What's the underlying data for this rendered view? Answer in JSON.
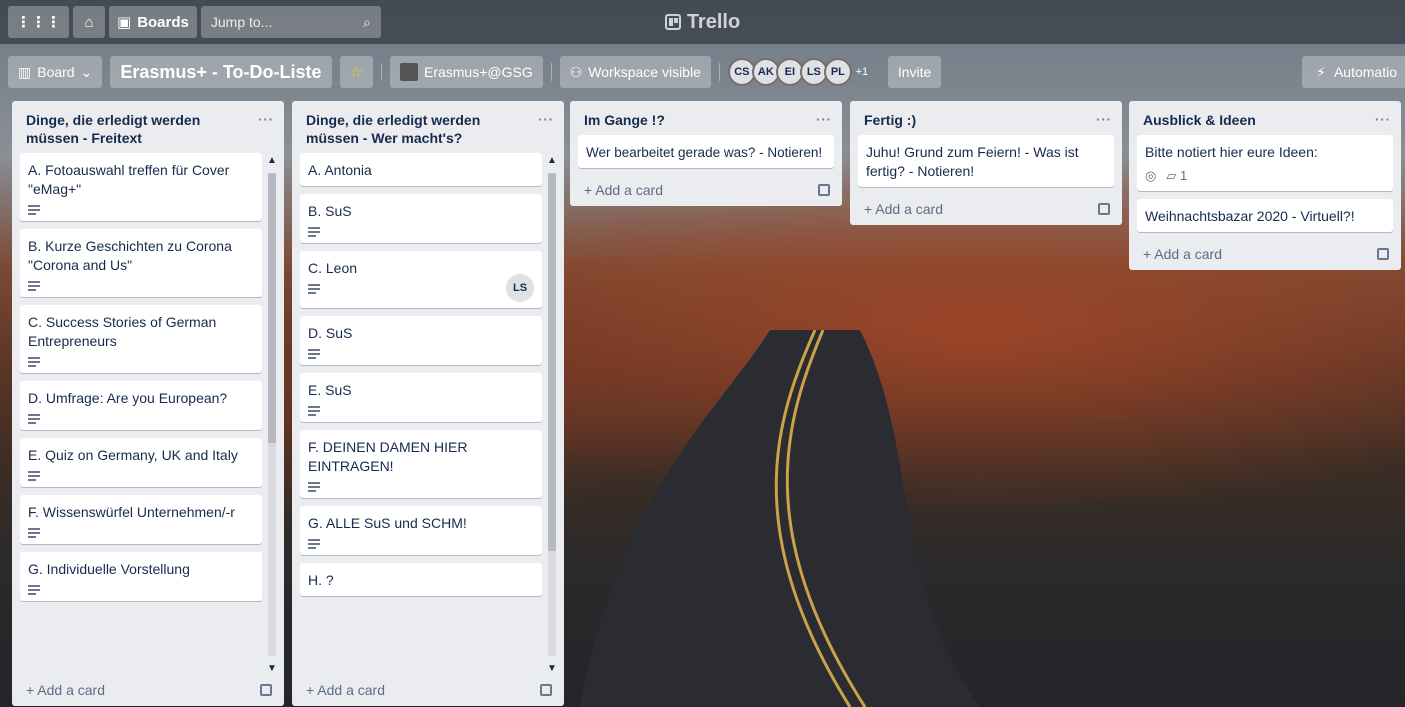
{
  "header": {
    "boards_label": "Boards",
    "search_placeholder": "Jump to...",
    "logo": "Trello"
  },
  "boardbar": {
    "view_label": "Board",
    "title": "Erasmus+ - To-Do-Liste",
    "workspace": "Erasmus+@GSG",
    "visibility": "Workspace visible",
    "members": [
      "CS",
      "AK",
      "EI",
      "LS",
      "PL"
    ],
    "more_members": "+1",
    "invite": "Invite",
    "automation": "Automatio"
  },
  "lists": [
    {
      "title": "Dinge, die erledigt werden müssen - Freitext",
      "cards": [
        "A. Fotoauswahl treffen für Cover \"eMag+\"",
        "B. Kurze Geschichten zu Corona \"Corona and Us\"",
        "C. Success Stories of German Entrepreneurs",
        "D. Umfrage: Are you European?",
        "E. Quiz on Germany, UK and Italy",
        "F. Wissenswürfel Unternehmen/-r",
        "G. Individuelle Vorstellung"
      ],
      "add_card": "Add a card"
    },
    {
      "title": "Dinge, die erledigt werden müssen - Wer macht's?",
      "cards": [
        "A. Antonia",
        "B. SuS",
        "C. Leon",
        "D. SuS",
        "E. SuS",
        "F. DEINEN DAMEN HIER EINTRAGEN!",
        "G. ALLE SuS und SCHM!",
        "H. ?"
      ],
      "card_member": "LS",
      "add_card": "Add a card"
    },
    {
      "title": "Im Gange !?",
      "cards": [
        "Wer bearbeitet gerade was? - Notieren!"
      ],
      "add_card": "Add a card"
    },
    {
      "title": "Fertig :)",
      "cards": [
        "Juhu! Grund zum Feiern! - Was ist fertig? - Notieren!"
      ],
      "add_card": "Add a card"
    },
    {
      "title": "Ausblick & Ideen",
      "cards": [
        "Bitte notiert hier eure Ideen:",
        "Weihnachtsbazar 2020 - Virtuell?!"
      ],
      "comment_count": "1",
      "add_card": "Add a card"
    }
  ],
  "icons": {
    "menu": "apps-grid-icon",
    "home": "home-icon",
    "boards": "board-icon",
    "search": "search-icon",
    "star": "star-icon",
    "visibility": "workspace-visible-icon",
    "automation": "lightning-icon",
    "description": "description-icon",
    "template": "card-template-icon",
    "watch": "eye-icon",
    "comment": "comment-icon"
  },
  "colors": {
    "star": "#f2d600",
    "list_bg": "#ebecf0",
    "text": "#172b4d"
  }
}
